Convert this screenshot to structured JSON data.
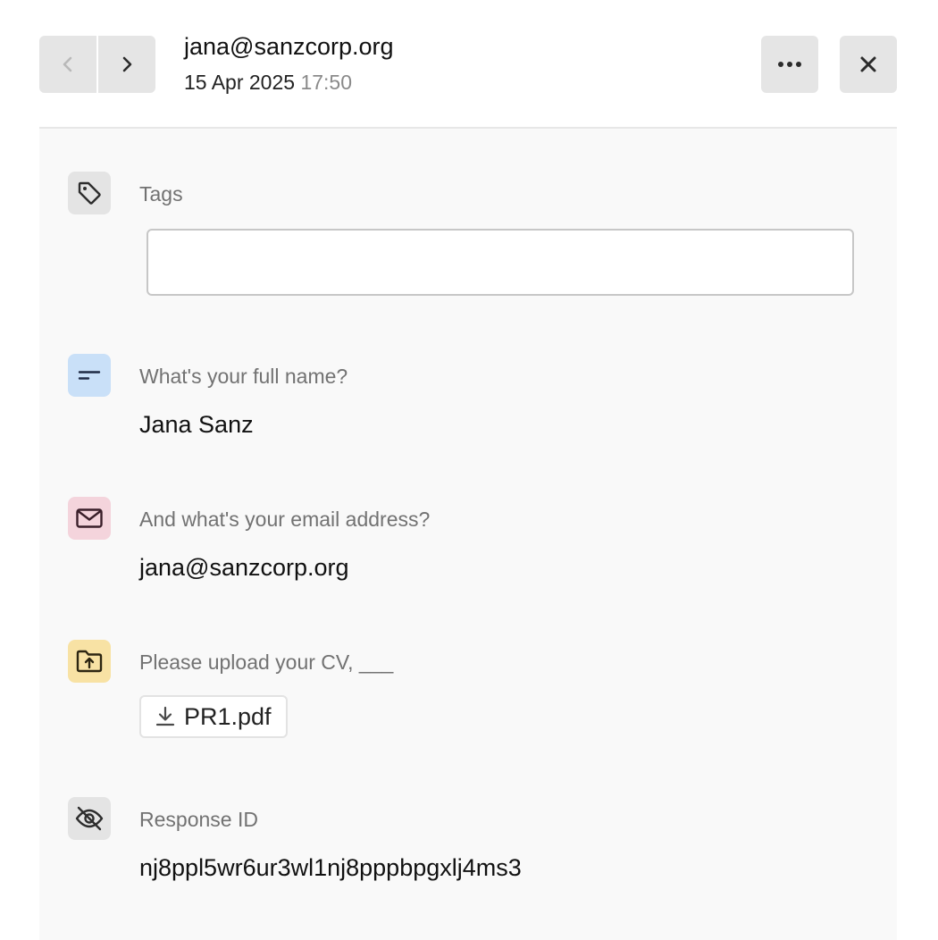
{
  "header": {
    "email": "jana@sanzcorp.org",
    "date": "15 Apr 2025",
    "time": "17:50",
    "prev_icon": "chevron-left-icon",
    "next_icon": "chevron-right-icon",
    "more_icon": "more-horizontal-icon",
    "close_icon": "close-icon"
  },
  "fields": {
    "tags": {
      "icon": "tag-icon",
      "label": "Tags",
      "value": "",
      "placeholder": ""
    },
    "name": {
      "icon": "short-text-icon",
      "icon_bg": "#c9e0f8",
      "label": "What's your full name?",
      "value": "Jana Sanz"
    },
    "email": {
      "icon": "mail-icon",
      "icon_bg": "#f4d4dc",
      "label": "And what's your email address?",
      "value": "jana@sanzcorp.org"
    },
    "cv": {
      "icon": "folder-upload-icon",
      "icon_bg": "#f8e2a4",
      "label": "Please upload your CV, ___",
      "file_icon": "download-icon",
      "file_name": "PR1.pdf"
    },
    "response_id": {
      "icon": "eye-off-icon",
      "icon_bg": "#e4e4e4",
      "label": "Response ID",
      "value": "nj8ppl5wr6ur3wl1nj8pppbpgxlj4ms3"
    }
  }
}
